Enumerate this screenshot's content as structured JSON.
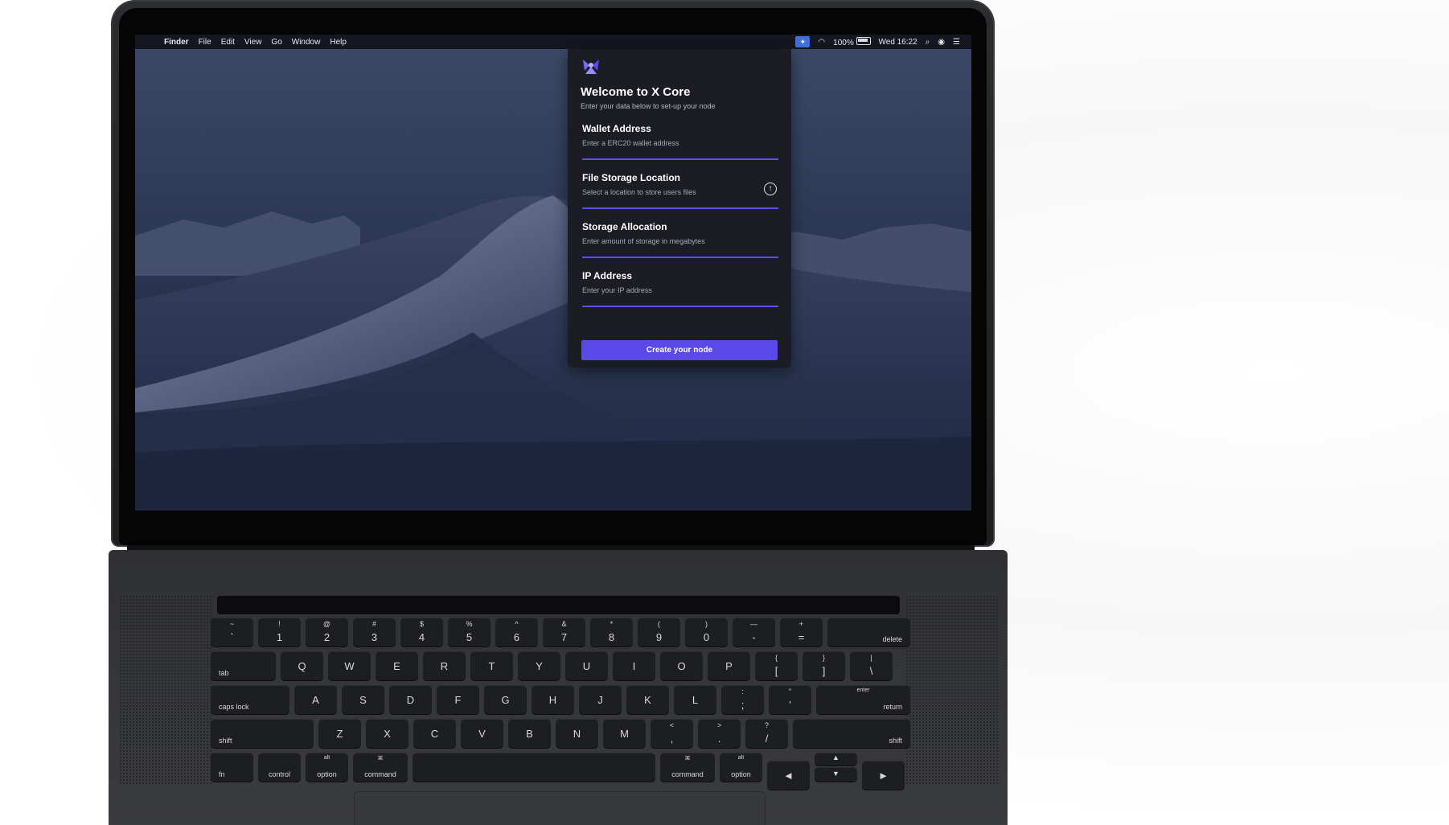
{
  "menubar": {
    "apple_icon": "apple-icon",
    "app_name": "Finder",
    "items": [
      "File",
      "Edit",
      "View",
      "Go",
      "Window",
      "Help"
    ],
    "battery": "100%",
    "clock": "Wed 16:22"
  },
  "panel": {
    "title": "Welcome to X Core",
    "subtitle": "Enter your data below to set-up your node",
    "fields": [
      {
        "label": "Wallet Address",
        "placeholder": "Enter a ERC20 wallet address"
      },
      {
        "label": "File Storage Location",
        "placeholder": "Select a location to store users files"
      },
      {
        "label": "Storage Allocation",
        "placeholder": "Enter amount of storage in megabytes"
      },
      {
        "label": "IP Address",
        "placeholder": "Enter your IP address"
      }
    ],
    "button": "Create your node",
    "accent_color": "#5a49e8"
  },
  "keyboard": {
    "row1": [
      [
        "~",
        "`"
      ],
      [
        "!",
        "1"
      ],
      [
        "@",
        "2"
      ],
      [
        "#",
        "3"
      ],
      [
        "$",
        "4"
      ],
      [
        "%",
        "5"
      ],
      [
        "^",
        "6"
      ],
      [
        "&",
        "7"
      ],
      [
        "*",
        "8"
      ],
      [
        "(",
        "9"
      ],
      [
        ")",
        "0"
      ],
      [
        "—",
        "-"
      ],
      [
        "+",
        "="
      ]
    ],
    "delete": "delete",
    "tab": "tab",
    "row2": [
      "Q",
      "W",
      "E",
      "R",
      "T",
      "Y",
      "U",
      "I",
      "O",
      "P"
    ],
    "row2_brackets": [
      [
        "{",
        "["
      ],
      [
        "}",
        "]"
      ],
      [
        "|",
        "\\"
      ]
    ],
    "caps_lock": "caps lock",
    "row3": [
      "A",
      "S",
      "D",
      "F",
      "G",
      "H",
      "J",
      "K",
      "L"
    ],
    "row3_punct": [
      [
        ":",
        ";"
      ],
      [
        "\"",
        "'"
      ]
    ],
    "enter": "enter",
    "return": "return",
    "shift": "shift",
    "row4": [
      "Z",
      "X",
      "C",
      "V",
      "B",
      "N",
      "M"
    ],
    "row4_punct": [
      [
        "<",
        ","
      ],
      [
        ">",
        "."
      ],
      [
        "?",
        "/"
      ]
    ],
    "fn": "fn",
    "control": "control",
    "alt": "alt",
    "option": "option",
    "command_symbol": "⌘",
    "command": "command",
    "arrow_left": "◄",
    "arrow_up": "▲",
    "arrow_down": "▼",
    "arrow_right": "►"
  }
}
